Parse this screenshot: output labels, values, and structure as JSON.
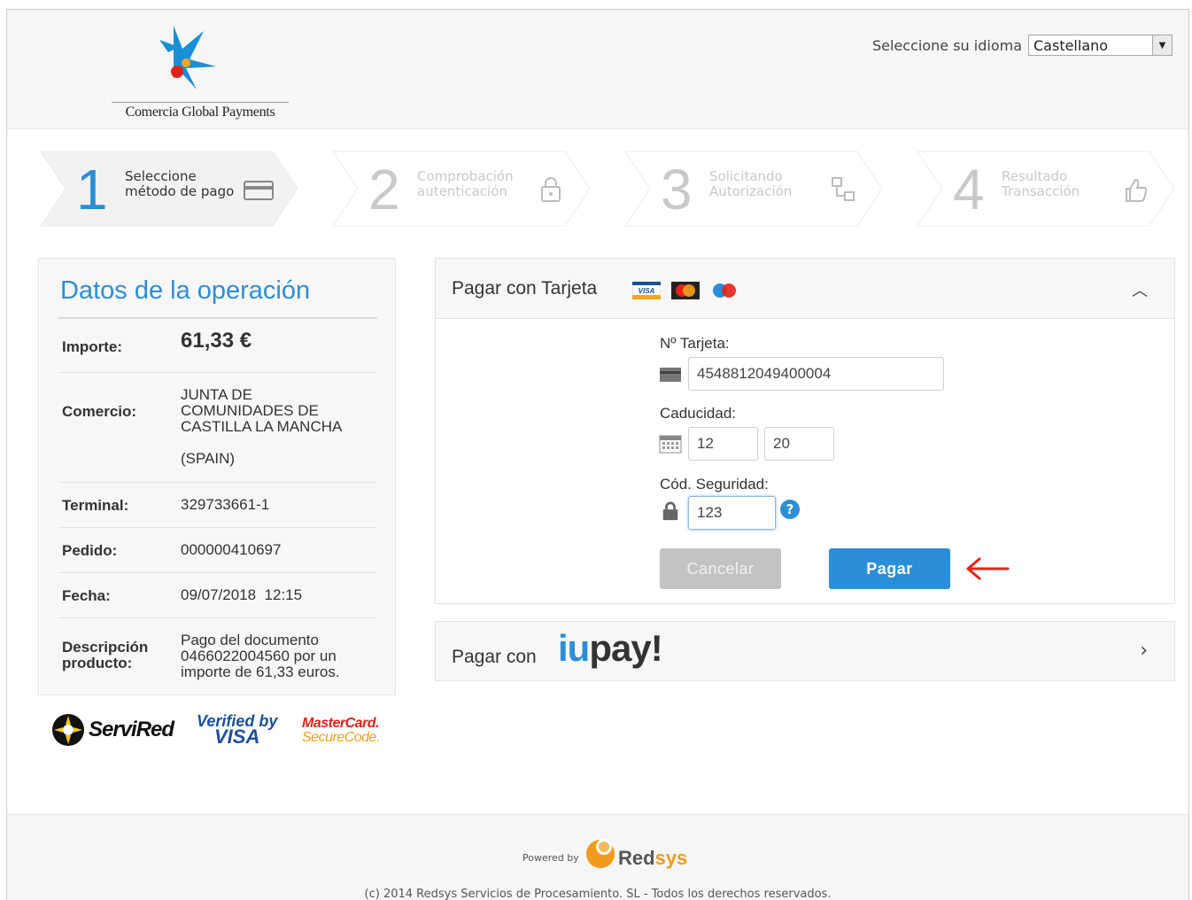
{
  "header": {
    "brand_text": "Comercia Global Payments",
    "language_label": "Seleccione su idioma",
    "language_value": "Castellano"
  },
  "steps": [
    {
      "number": "1",
      "line1": "Seleccione",
      "line2": "método de pago",
      "icon": "card-icon",
      "state": "active"
    },
    {
      "number": "2",
      "line1": "Comprobación",
      "line2": "autenticación",
      "icon": "lock-icon",
      "state": "inactive"
    },
    {
      "number": "3",
      "line1": "Solicitando",
      "line2": "Autorización",
      "icon": "network-icon",
      "state": "inactive"
    },
    {
      "number": "4",
      "line1": "Resultado",
      "line2": "Transacción",
      "icon": "thumbs-up-icon",
      "state": "inactive"
    }
  ],
  "operation": {
    "title": "Datos de la operación",
    "rows": [
      {
        "label": "Importe:",
        "value": "61,33 €"
      },
      {
        "label": "Comercio:",
        "value_lines": [
          "JUNTA DE",
          "COMUNIDADES DE",
          "CASTILLA LA MANCHA",
          "(SPAIN)"
        ]
      },
      {
        "label": "Terminal:",
        "value": "329733661-1"
      },
      {
        "label": "Pedido:",
        "value": "000000410697"
      },
      {
        "label": "Fecha:",
        "value": "09/07/2018  12:15"
      },
      {
        "label_lines": [
          "Descripción",
          "producto:"
        ],
        "value_lines": [
          "Pago del documento",
          "0466022004560 por un",
          "importe de 61,33 euros."
        ]
      }
    ]
  },
  "badges": {
    "servired": "ServiRed",
    "verified_line1": "Verified by",
    "verified_line2": "VISA",
    "mc_line1": "MasterCard.",
    "mc_line2": "SecureCode."
  },
  "card_form": {
    "title": "Pagar con Tarjeta",
    "card_number_label": "Nº Tarjeta:",
    "card_number_value": "4548812049400004",
    "expiry_label": "Caducidad:",
    "expiry_month": "12",
    "expiry_year": "20",
    "cvv_label": "Cód. Seguridad:",
    "cvv_value": "123",
    "help_symbol": "?",
    "cancel_label": "Cancelar",
    "pay_label": "Pagar",
    "card_logo_visa": "VISA"
  },
  "iupay": {
    "title": "Pagar con",
    "logo_a": "iu",
    "logo_b": "pay!"
  },
  "footer": {
    "powered_by": "Powered by",
    "redsys_a": "Red",
    "redsys_b": "sys",
    "copyright": "(c) 2014 Redsys Servicios de Procesamiento. SL - Todos los derechos reservados."
  },
  "colors": {
    "accent": "#2b8ed8",
    "muted": "#c9c9c9",
    "arrow": "#e2231a"
  }
}
